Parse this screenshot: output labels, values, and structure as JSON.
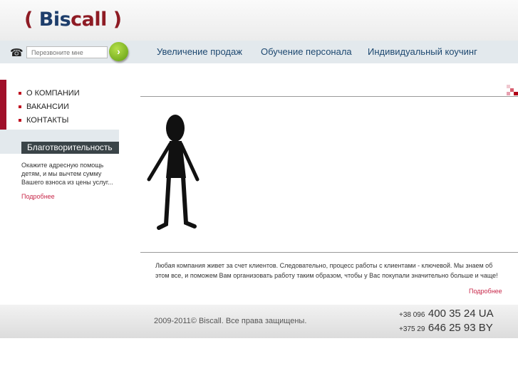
{
  "logo": {
    "text": "Biscall"
  },
  "callback": {
    "placeholder": "Перезвоните мне"
  },
  "nav": [
    "Увеличение продаж",
    "Обучение персонала",
    "Индивидуальный коучинг"
  ],
  "menu": [
    "О КОМПАНИИ",
    "ВАКАНСИИ",
    "КОНТАКТЫ"
  ],
  "charity": {
    "title": "Благотворительность",
    "text": "Окажите адресную помощь детям, и мы вычтем сумму Вашего взноса из цены услуг...",
    "more": "Подробнее"
  },
  "main": {
    "text": "Любая компания живет за счет клиентов. Следовательно, процесс работы с клиентами - ключевой. Мы знаем об этом все, и поможем Вам организовать работу таким образом, чтобы у Вас покупали значительно больше и чаще!",
    "more": "Подробнее"
  },
  "footer": {
    "copyright": "2009-2011© Biscall. Все права защищены.",
    "phones": [
      {
        "prefix": "+38 096",
        "number": "400 35 24 UA"
      },
      {
        "prefix": "+375 29",
        "number": "646 25 93 BY"
      }
    ]
  }
}
